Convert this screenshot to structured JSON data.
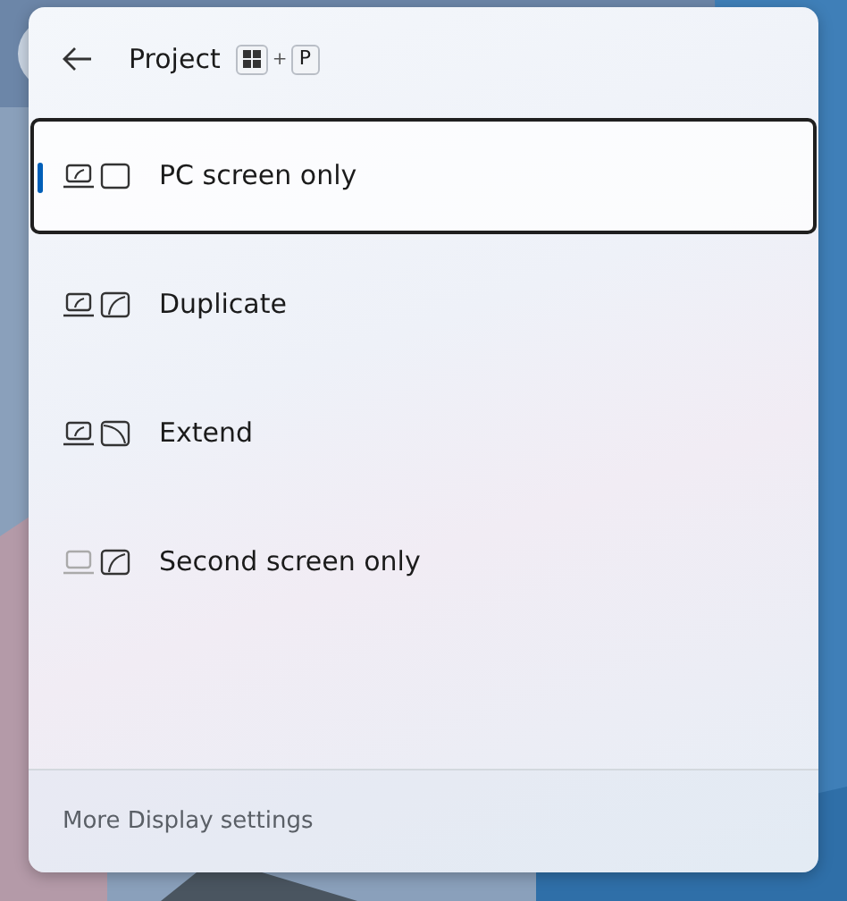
{
  "header": {
    "title": "Project",
    "shortcut_key": "P",
    "shortcut_plus": "+"
  },
  "options": [
    {
      "label": "PC screen only",
      "kind": "pc_only",
      "selected": true
    },
    {
      "label": "Duplicate",
      "kind": "duplicate",
      "selected": false
    },
    {
      "label": "Extend",
      "kind": "extend",
      "selected": false
    },
    {
      "label": "Second screen only",
      "kind": "second_only",
      "selected": false
    }
  ],
  "footer": {
    "link": "More Display settings"
  }
}
